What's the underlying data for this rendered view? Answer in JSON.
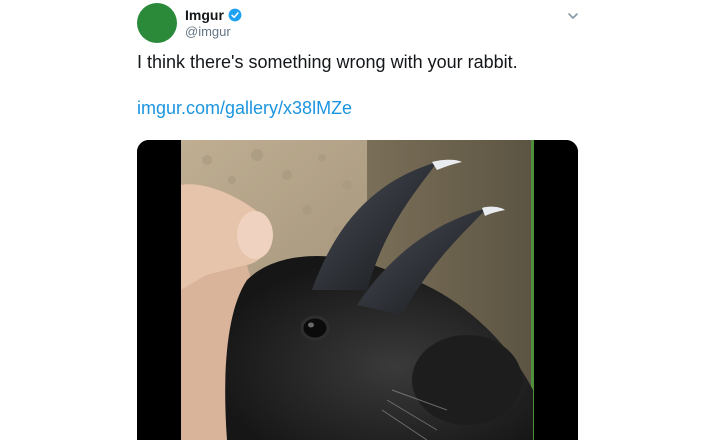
{
  "tweet": {
    "author": {
      "name": "Imgur",
      "handle": "@imgur",
      "verified": true,
      "avatar_color": "#2b8a3a"
    },
    "text": "I think there's something wrong with your rabbit.",
    "link": "imgur.com/gallery/x38lMZe",
    "media": {
      "type": "video",
      "subject": "black rabbit with curved horn-like ears"
    }
  },
  "colors": {
    "link": "#1b95e0",
    "verified_badge": "#1da1f2",
    "secondary_text": "#657786"
  },
  "icons": [
    "verified-badge-icon",
    "chevron-down-icon"
  ]
}
